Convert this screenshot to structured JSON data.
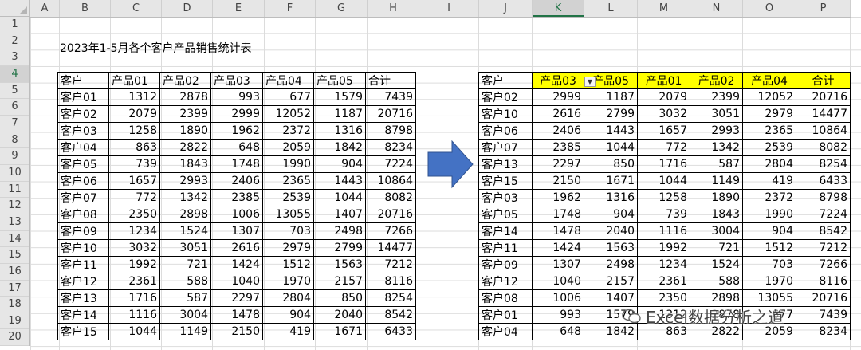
{
  "columns": [
    "A",
    "B",
    "C",
    "D",
    "E",
    "F",
    "G",
    "H",
    "I",
    "J",
    "K",
    "L",
    "M",
    "N",
    "O",
    "P"
  ],
  "rows": [
    "1",
    "2",
    "3",
    "4",
    "5",
    "6",
    "7",
    "8",
    "9",
    "10",
    "11",
    "12",
    "13",
    "14",
    "15",
    "16",
    "17",
    "18",
    "19",
    "20"
  ],
  "selected_cell": {
    "column": "K",
    "row": "4"
  },
  "title": "2023年1-5月各个客户产品销售统计表",
  "left_table": {
    "headers": [
      "客户",
      "产品01",
      "产品02",
      "产品03",
      "产品04",
      "产品05",
      "合计"
    ],
    "rows": [
      [
        "客户01",
        "1312",
        "2878",
        "993",
        "677",
        "1579",
        "7439"
      ],
      [
        "客户02",
        "2079",
        "2399",
        "2999",
        "12052",
        "1187",
        "20716"
      ],
      [
        "客户03",
        "1258",
        "1890",
        "1962",
        "2372",
        "1316",
        "8798"
      ],
      [
        "客户04",
        "863",
        "2822",
        "648",
        "2059",
        "1842",
        "8234"
      ],
      [
        "客户05",
        "739",
        "1843",
        "1748",
        "1990",
        "904",
        "7224"
      ],
      [
        "客户06",
        "1657",
        "2993",
        "2406",
        "2365",
        "1443",
        "10864"
      ],
      [
        "客户07",
        "772",
        "1342",
        "2385",
        "2539",
        "1044",
        "8082"
      ],
      [
        "客户08",
        "2350",
        "2898",
        "1006",
        "13055",
        "1407",
        "20716"
      ],
      [
        "客户09",
        "1234",
        "1524",
        "1307",
        "703",
        "2498",
        "7266"
      ],
      [
        "客户10",
        "3032",
        "3051",
        "2616",
        "2979",
        "2799",
        "14477"
      ],
      [
        "客户11",
        "1992",
        "721",
        "1424",
        "1512",
        "1563",
        "7212"
      ],
      [
        "客户12",
        "2361",
        "588",
        "1040",
        "1970",
        "2157",
        "8116"
      ],
      [
        "客户13",
        "1716",
        "587",
        "2297",
        "2804",
        "850",
        "8254"
      ],
      [
        "客户14",
        "1116",
        "3004",
        "1478",
        "904",
        "2040",
        "8542"
      ],
      [
        "客户15",
        "1044",
        "1149",
        "2150",
        "419",
        "1671",
        "6433"
      ]
    ]
  },
  "right_table": {
    "headers": [
      "客户",
      "产品03",
      "产品05",
      "产品01",
      "产品02",
      "产品04",
      "合计"
    ],
    "header_highlight": "#ffff00",
    "rows": [
      [
        "客户02",
        "2999",
        "1187",
        "2079",
        "2399",
        "12052",
        "20716"
      ],
      [
        "客户10",
        "2616",
        "2799",
        "3032",
        "3051",
        "2979",
        "14477"
      ],
      [
        "客户06",
        "2406",
        "1443",
        "1657",
        "2993",
        "2365",
        "10864"
      ],
      [
        "客户07",
        "2385",
        "1044",
        "772",
        "1342",
        "2539",
        "8082"
      ],
      [
        "客户13",
        "2297",
        "850",
        "1716",
        "587",
        "2804",
        "8254"
      ],
      [
        "客户15",
        "2150",
        "1671",
        "1044",
        "1149",
        "419",
        "6433"
      ],
      [
        "客户03",
        "1962",
        "1316",
        "1258",
        "1890",
        "2372",
        "8798"
      ],
      [
        "客户05",
        "1748",
        "904",
        "739",
        "1843",
        "1990",
        "7224"
      ],
      [
        "客户14",
        "1478",
        "2040",
        "1116",
        "3004",
        "904",
        "8542"
      ],
      [
        "客户11",
        "1424",
        "1563",
        "1992",
        "721",
        "1512",
        "7212"
      ],
      [
        "客户09",
        "1307",
        "2498",
        "1234",
        "1524",
        "703",
        "7266"
      ],
      [
        "客户12",
        "1040",
        "2157",
        "2361",
        "588",
        "1970",
        "8116"
      ],
      [
        "客户08",
        "1006",
        "1407",
        "2350",
        "2898",
        "13055",
        "20716"
      ],
      [
        "客户01",
        "993",
        "1579",
        "1312",
        "2878",
        "677",
        "7439"
      ],
      [
        "客户04",
        "648",
        "1842",
        "863",
        "2822",
        "2059",
        "8234"
      ]
    ]
  },
  "arrow_color": "#4472c4",
  "watermark_text": "Excel数据分析之道"
}
